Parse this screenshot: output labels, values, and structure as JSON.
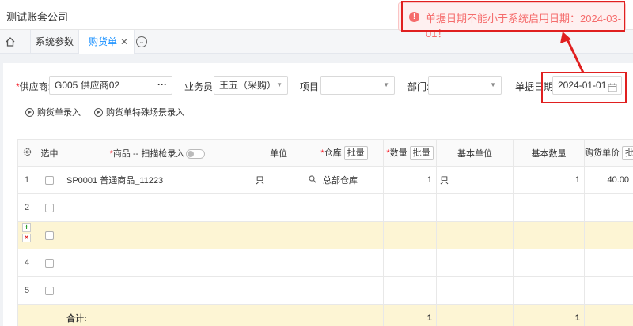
{
  "app": {
    "company": "测试账套公司"
  },
  "tabs": [
    {
      "label": "系统参数"
    },
    {
      "label": "购货单",
      "close": "✕"
    }
  ],
  "form": {
    "supplier": {
      "label": "供应商:",
      "value": "G005 供应商02",
      "more": "···"
    },
    "salesman": {
      "label": "业务员:",
      "value": "王五（采购）"
    },
    "project": {
      "label": "项目:",
      "value": ""
    },
    "department": {
      "label": "部门:",
      "value": ""
    },
    "doc_date": {
      "label": "单据日期:",
      "value": "2024-01-01"
    }
  },
  "entry_buttons": [
    "购货单录入",
    "购货单特殊场景录入"
  ],
  "table": {
    "headers": {
      "select": "选中",
      "product": "商品 -- 扫描枪录入",
      "unit": "单位",
      "warehouse": "仓库",
      "quantity": "数量",
      "base_unit": "基本单位",
      "base_qty": "基本数量",
      "price": "购货单价",
      "batch": "批量"
    },
    "rows": [
      {
        "no": "1",
        "product": "SP0001 普通商品_11223",
        "unit": "只",
        "warehouse": "总部仓库",
        "quantity": "1",
        "base_unit": "只",
        "base_qty": "1",
        "price": "40.00"
      },
      {
        "no": "2",
        "product": "",
        "unit": "",
        "warehouse": "",
        "quantity": "",
        "base_unit": "",
        "base_qty": "",
        "price": ""
      },
      {
        "no": "",
        "product": "",
        "unit": "",
        "warehouse": "",
        "quantity": "",
        "base_unit": "",
        "base_qty": "",
        "price": ""
      },
      {
        "no": "4",
        "product": "",
        "unit": "",
        "warehouse": "",
        "quantity": "",
        "base_unit": "",
        "base_qty": "",
        "price": ""
      },
      {
        "no": "5",
        "product": "",
        "unit": "",
        "warehouse": "",
        "quantity": "",
        "base_unit": "",
        "base_qty": "",
        "price": ""
      }
    ],
    "total": {
      "label": "合计:",
      "quantity": "1",
      "base_qty": "1"
    }
  },
  "toast": {
    "message": "单据日期不能小于系统启用日期：2024-03-01！",
    "icon": "!"
  },
  "colors": {
    "accent": "#1890ff",
    "error": "#f56c6c",
    "highlight": "#e02020",
    "active_row": "#fdf5d4"
  }
}
